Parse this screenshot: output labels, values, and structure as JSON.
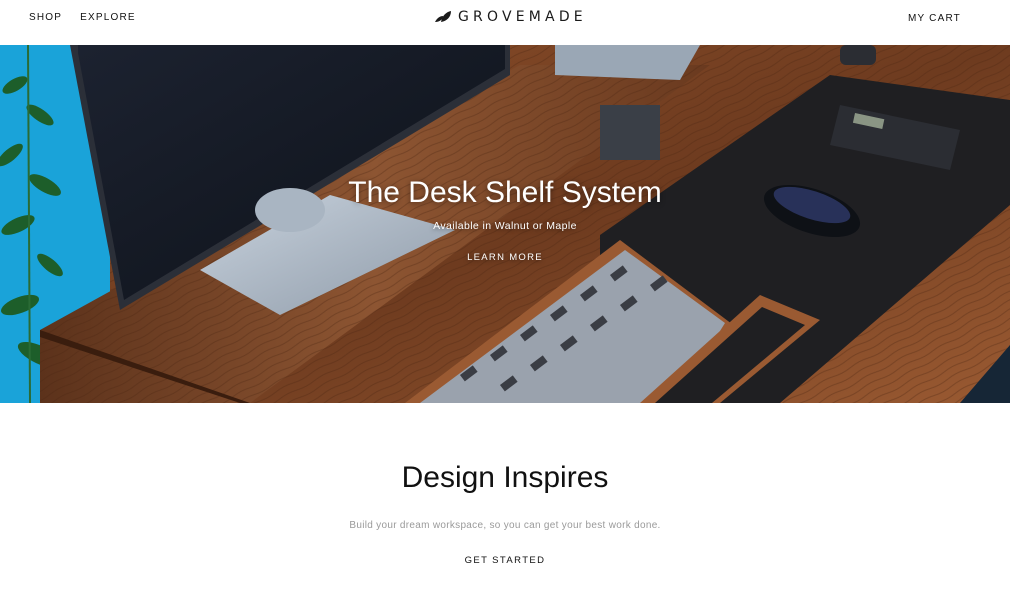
{
  "header": {
    "nav": [
      {
        "label": "SHOP"
      },
      {
        "label": "EXPLORE"
      }
    ],
    "logo_text": "GROVEMADE",
    "cart_label": "MY CART"
  },
  "hero": {
    "title": "The Desk Shelf System",
    "subtitle": "Available in Walnut or Maple",
    "cta_label": "LEARN MORE"
  },
  "section": {
    "title": "Design Inspires",
    "subtitle": "Build your dream workspace, so you can get your best work done.",
    "cta_label": "GET STARTED"
  },
  "colors": {
    "text": "#111111",
    "muted": "#9a9a9a",
    "walnut": "#7a4526",
    "desk_pad": "#1f1f22",
    "backdrop": "#1aa3d9"
  }
}
